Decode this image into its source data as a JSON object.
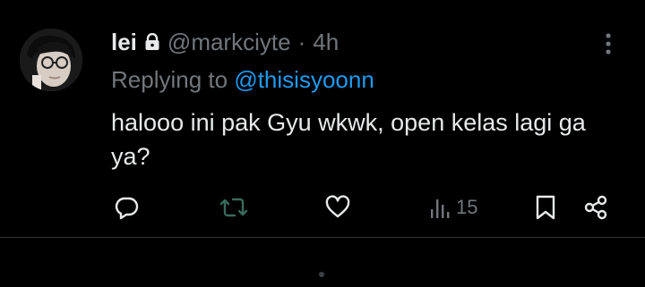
{
  "tweet": {
    "display_name": "lei",
    "handle": "@markciyte",
    "separator": "·",
    "time": "4h",
    "replying_prefix": "Replying to",
    "replying_to": "@thisisyoonn",
    "text": "halooo ini pak Gyu wkwk, open kelas lagi ga ya?",
    "views_count": "15",
    "protected_icon": "lock-icon",
    "more_icon": "more-vertical-icon"
  },
  "actions": [
    {
      "name": "reply",
      "icon": "reply-icon"
    },
    {
      "name": "retweet",
      "icon": "retweet-icon"
    },
    {
      "name": "like",
      "icon": "heart-icon"
    },
    {
      "name": "views",
      "icon": "views-icon"
    },
    {
      "name": "bookmark",
      "icon": "bookmark-icon"
    },
    {
      "name": "share",
      "icon": "share-icon"
    }
  ],
  "colors": {
    "background": "#000000",
    "text": "#e7e9ea",
    "muted": "#71767b",
    "accent": "#1d9bf0",
    "divider": "#2f3336",
    "retweet_disabled": "#3a6a5c"
  }
}
